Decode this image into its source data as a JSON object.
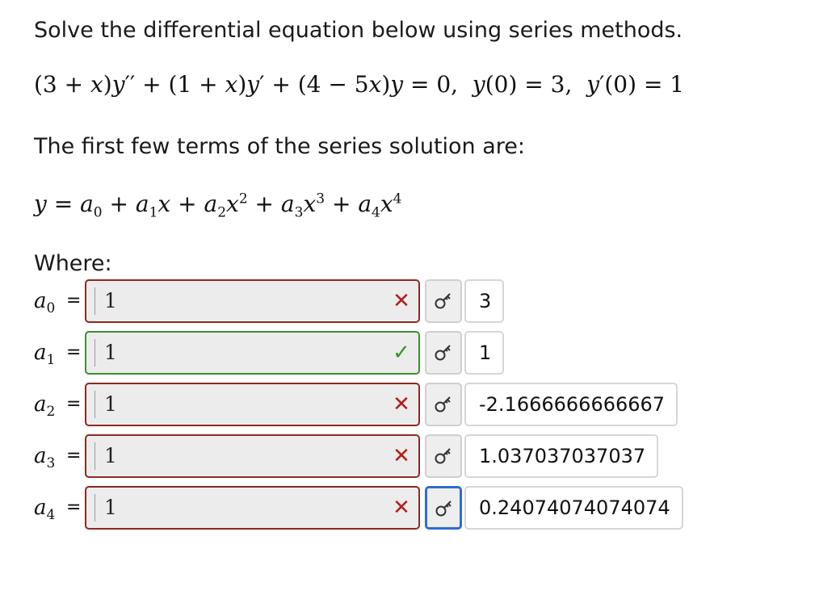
{
  "instruction": "Solve the differential equation below using series methods.",
  "equation": {
    "lhs_a": "(3 + ",
    "x1": "x",
    "lhs_b": ")",
    "y1": "y",
    "pp": "′′",
    "mid_a": " + (1 + ",
    "x2": "x",
    "mid_b": ")",
    "y2": "y",
    "p": "′",
    "mid_c": " + (4 − 5",
    "x3": "x",
    "mid_d": ")",
    "y3": "y",
    "rhs": " = 0,",
    "ic1_y": "y",
    "ic1_rest": "(0) = 3,",
    "ic2_y": "y",
    "ic2_p": "′",
    "ic2_rest": "(0) = 1"
  },
  "series_intro": "The first few terms of the series solution are:",
  "series": {
    "y": "y",
    "eq": " = ",
    "a0": "a",
    "s0": "0",
    "plus1": " + ",
    "a1": "a",
    "s1": "1",
    "x1": "x",
    "plus2": " + ",
    "a2": "a",
    "s2": "2",
    "x2": "x",
    "e2": "2",
    "plus3": " + ",
    "a3": "a",
    "s3": "3",
    "x3": "x",
    "e3": "3",
    "plus4": " + ",
    "a4": "a",
    "s4": "4",
    "x4": "x",
    "e4": "4"
  },
  "where_label": "Where:",
  "rows": [
    {
      "coef": "a",
      "sub": "0",
      "eq": "=",
      "entered": "1",
      "status": "incorrect",
      "mark": "✕",
      "answer": "3"
    },
    {
      "coef": "a",
      "sub": "1",
      "eq": "=",
      "entered": "1",
      "status": "correct",
      "mark": "✓",
      "answer": "1"
    },
    {
      "coef": "a",
      "sub": "2",
      "eq": "=",
      "entered": "1",
      "status": "incorrect",
      "mark": "✕",
      "answer": "-2.1666666666667"
    },
    {
      "coef": "a",
      "sub": "3",
      "eq": "=",
      "entered": "1",
      "status": "incorrect",
      "mark": "✕",
      "answer": "1.037037037037"
    },
    {
      "coef": "a",
      "sub": "4",
      "eq": "=",
      "entered": "1",
      "status": "incorrect",
      "mark": "✕",
      "answer": "0.24074074074074"
    }
  ],
  "icons": {
    "answer_key": "key-icon",
    "incorrect": "x-mark-icon",
    "correct": "check-mark-icon"
  },
  "colors": {
    "incorrect": "#8b2a22",
    "correct": "#3a8f2e",
    "focus": "#2e6bd6"
  }
}
